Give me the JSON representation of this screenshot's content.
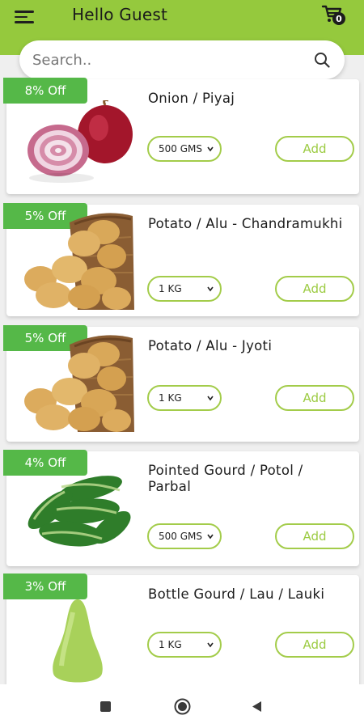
{
  "header": {
    "title": "Hello Guest",
    "cart_count": "0",
    "brand_color": "#95c93d"
  },
  "search": {
    "placeholder": "Search.."
  },
  "products": [
    {
      "discount": "8% Off",
      "name": "Onion / Piyaj",
      "unit": "500 GMS",
      "add_label": "Add",
      "image": "onion"
    },
    {
      "discount": "5% Off",
      "name": "Potato / Alu - Chandramukhi",
      "unit": "1 KG",
      "add_label": "Add",
      "image": "potatoes"
    },
    {
      "discount": "5% Off",
      "name": "Potato / Alu - Jyoti",
      "unit": "1 KG",
      "add_label": "Add",
      "image": "potatoes"
    },
    {
      "discount": "4% Off",
      "name": "Pointed Gourd / Potol / Parbal",
      "unit": "500 GMS",
      "add_label": "Add",
      "image": "pointed-gourd"
    },
    {
      "discount": "3% Off",
      "name": "Bottle Gourd / Lau / Lauki",
      "unit": "1 KG",
      "add_label": "Add",
      "image": "bottle-gourd"
    }
  ],
  "colors": {
    "discount_badge": "#55b848",
    "accent_border": "#a3cc4a"
  },
  "system_nav": {
    "icons": [
      "recent-apps-icon",
      "home-icon",
      "back-icon"
    ]
  }
}
